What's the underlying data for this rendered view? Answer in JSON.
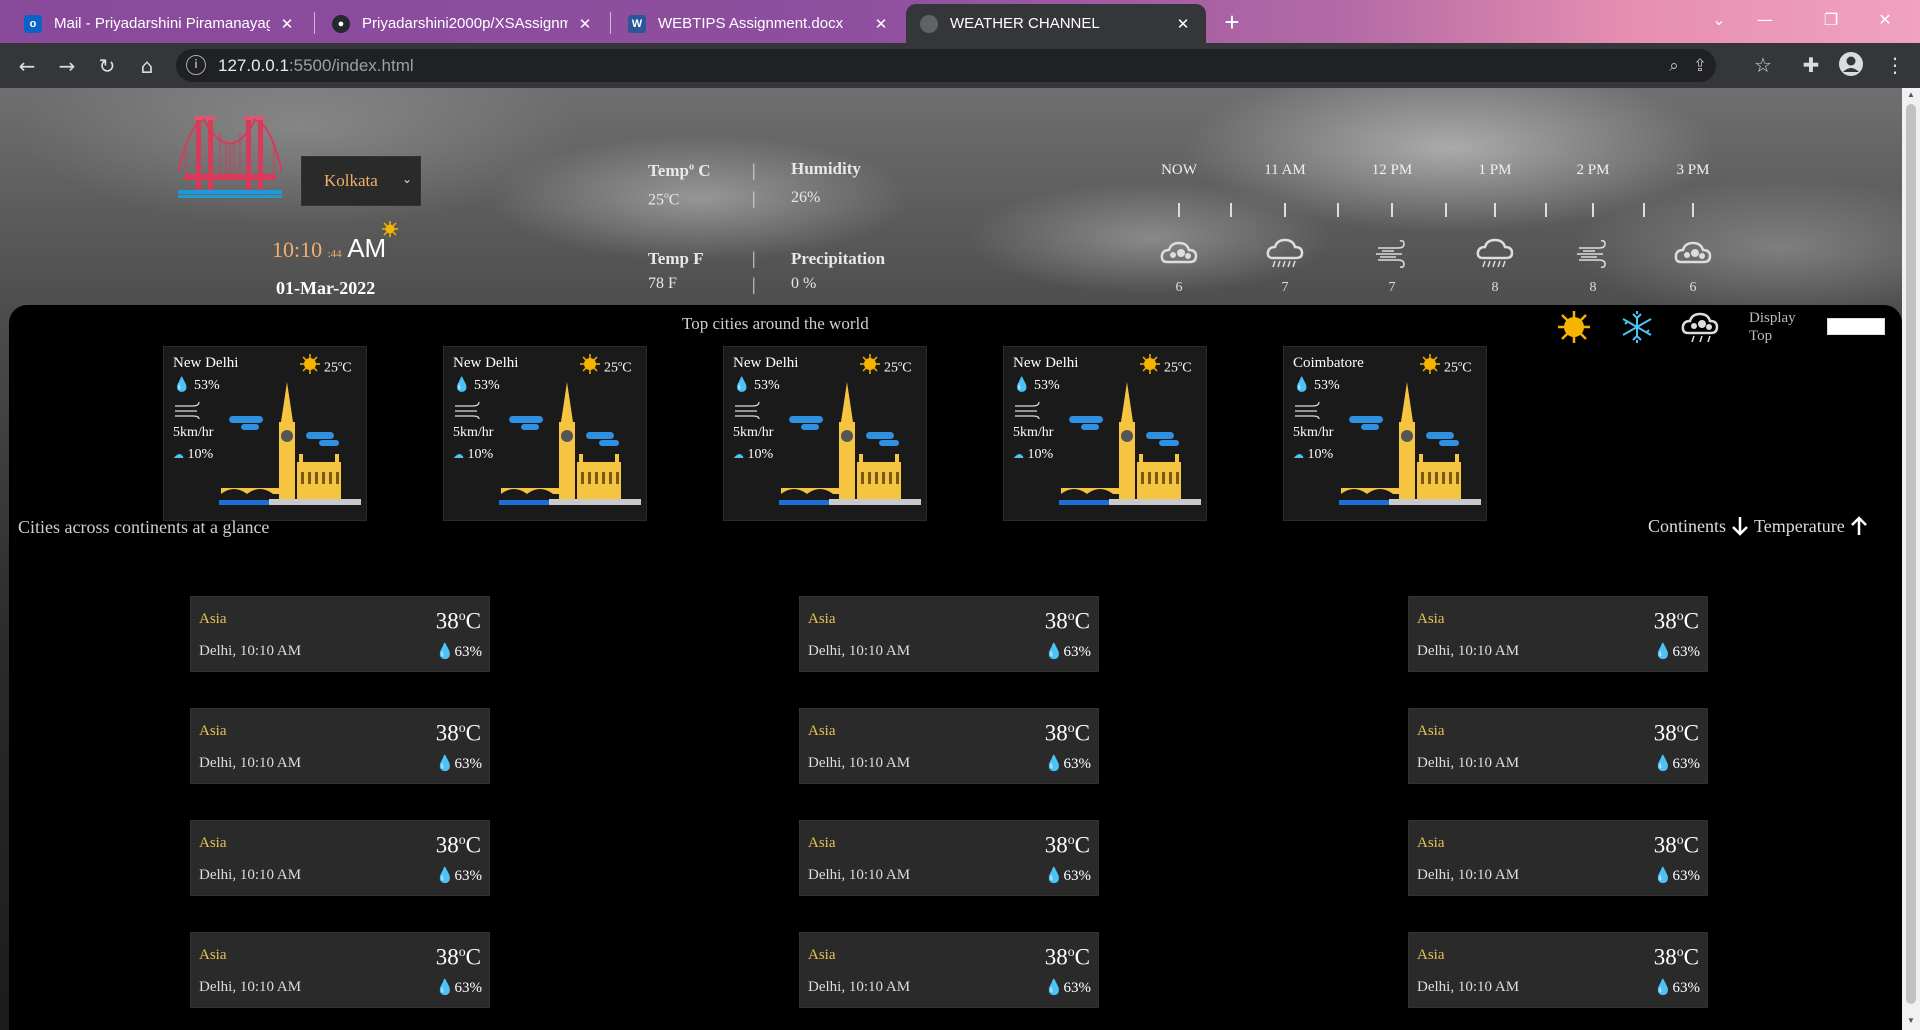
{
  "browser": {
    "tabs": [
      {
        "title": "Mail - Priyadarshini Piramanayag",
        "favicon": "outlook-icon"
      },
      {
        "title": "Priyadarshini2000p/XSAssignmen",
        "favicon": "github-icon"
      },
      {
        "title": "WEBTIPS Assignment.docx",
        "favicon": "word-icon"
      },
      {
        "title": "WEATHER CHANNEL",
        "favicon": "globe-icon"
      }
    ],
    "url_host": "127.0.0.1",
    "url_path": ":5500/index.html"
  },
  "header": {
    "city": "Kolkata",
    "time": "10:10",
    "seconds": ":44",
    "ampm": "AM",
    "date": "01-Mar-2022",
    "temp_c_label": "Temp",
    "temp_c_unit": "o",
    "temp_c_suffix": " C",
    "temp_c_value": "25",
    "temp_c_value_unit": "C",
    "humidity_label": "Humidity",
    "humidity_value": "26%",
    "temp_f_label": "Temp F",
    "temp_f_value": "78 F",
    "precip_label": "Precipitation",
    "precip_value": "0 %",
    "sep": "|"
  },
  "hourly": [
    {
      "label": "NOW",
      "value": "6",
      "icon": "rain-cloud-icon"
    },
    {
      "label": "11 AM",
      "value": "7",
      "icon": "heavy-rain-icon"
    },
    {
      "label": "12 PM",
      "value": "7",
      "icon": "wind-icon"
    },
    {
      "label": "1 PM",
      "value": "8",
      "icon": "heavy-rain-icon"
    },
    {
      "label": "2 PM",
      "value": "8",
      "icon": "wind-icon"
    },
    {
      "label": "3 PM",
      "value": "6",
      "icon": "rain-cloud-icon"
    }
  ],
  "top_cities": {
    "title": "Top cities around the world",
    "display_label": "Display Top",
    "cards": [
      {
        "name": "New Delhi",
        "temp": "25",
        "unit": "C",
        "humidity": "53%",
        "wind": "5km/hr",
        "precip": "10%"
      },
      {
        "name": "New Delhi",
        "temp": "25",
        "unit": "C",
        "humidity": "53%",
        "wind": "5km/hr",
        "precip": "10%"
      },
      {
        "name": "New Delhi",
        "temp": "25",
        "unit": "C",
        "humidity": "53%",
        "wind": "5km/hr",
        "precip": "10%"
      },
      {
        "name": "New Delhi",
        "temp": "25",
        "unit": "C",
        "humidity": "53%",
        "wind": "5km/hr",
        "precip": "10%"
      },
      {
        "name": "Coimbatore",
        "temp": "25",
        "unit": "C",
        "humidity": "53%",
        "wind": "5km/hr",
        "precip": "10%"
      }
    ]
  },
  "glance": {
    "title": "Cities across continents at a glance",
    "sort_continents": "Continents",
    "sort_temperature": "Temperature",
    "cards": [
      {
        "continent": "Asia",
        "city_time": "Delhi, 10:10 AM",
        "temp": "38",
        "unit": "C",
        "humidity": "63%"
      },
      {
        "continent": "Asia",
        "city_time": "Delhi, 10:10 AM",
        "temp": "38",
        "unit": "C",
        "humidity": "63%"
      },
      {
        "continent": "Asia",
        "city_time": "Delhi, 10:10 AM",
        "temp": "38",
        "unit": "C",
        "humidity": "63%"
      },
      {
        "continent": "Asia",
        "city_time": "Delhi, 10:10 AM",
        "temp": "38",
        "unit": "C",
        "humidity": "63%"
      },
      {
        "continent": "Asia",
        "city_time": "Delhi, 10:10 AM",
        "temp": "38",
        "unit": "C",
        "humidity": "63%"
      },
      {
        "continent": "Asia",
        "city_time": "Delhi, 10:10 AM",
        "temp": "38",
        "unit": "C",
        "humidity": "63%"
      },
      {
        "continent": "Asia",
        "city_time": "Delhi, 10:10 AM",
        "temp": "38",
        "unit": "C",
        "humidity": "63%"
      },
      {
        "continent": "Asia",
        "city_time": "Delhi, 10:10 AM",
        "temp": "38",
        "unit": "C",
        "humidity": "63%"
      },
      {
        "continent": "Asia",
        "city_time": "Delhi, 10:10 AM",
        "temp": "38",
        "unit": "C",
        "humidity": "63%"
      },
      {
        "continent": "Asia",
        "city_time": "Delhi, 10:10 AM",
        "temp": "38",
        "unit": "C",
        "humidity": "63%"
      },
      {
        "continent": "Asia",
        "city_time": "Delhi, 10:10 AM",
        "temp": "38",
        "unit": "C",
        "humidity": "63%"
      },
      {
        "continent": "Asia",
        "city_time": "Delhi, 10:10 AM",
        "temp": "38",
        "unit": "C",
        "humidity": "63%"
      }
    ]
  },
  "colors": {
    "accent": "#f0b06a",
    "continent": "#e6c25a",
    "panel": "#000000"
  }
}
